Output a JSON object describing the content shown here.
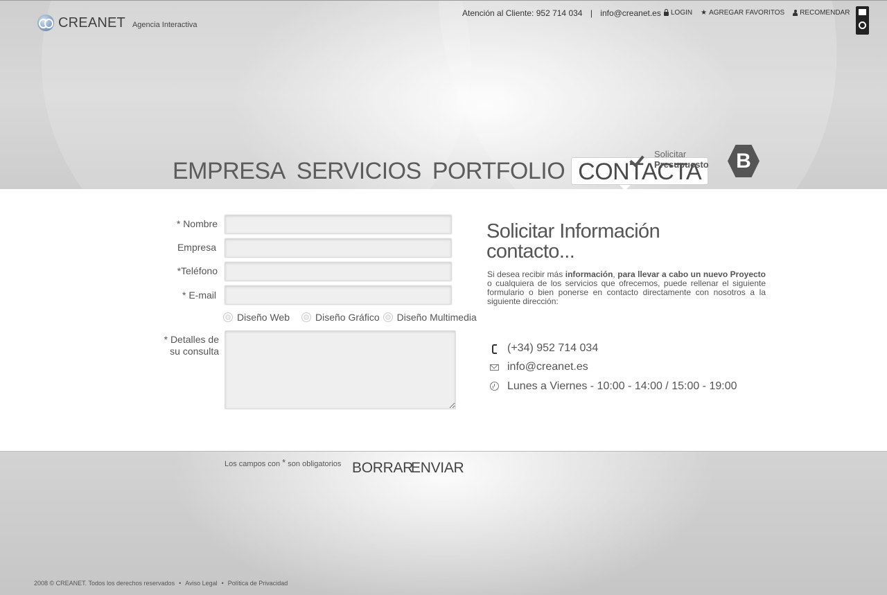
{
  "header": {
    "brand": "CREANET",
    "tagline": "Agencia Interactiva",
    "attention_text": "Atención al Cliente: 952 714 034",
    "separator": "|",
    "email_link": "info@creanet.es",
    "links": {
      "login": "LOGIN",
      "favorites": "AGREGAR FAVORITOS",
      "recommend": "RECOMENDAR"
    }
  },
  "nav": {
    "items": [
      {
        "label": "EMPRESA"
      },
      {
        "label": "SERVICIOS"
      },
      {
        "label": "PORTFOLIO"
      },
      {
        "label": "CONTACTA",
        "active": true
      }
    ]
  },
  "presupuesto": {
    "line1": "Solicitar",
    "line2": "Presupuesto",
    "badge": "B"
  },
  "form": {
    "fields": {
      "nombre": {
        "label": "* Nombre",
        "value": ""
      },
      "empresa": {
        "label": "Empresa",
        "value": ""
      },
      "telefono": {
        "label": "*Teléfono",
        "value": ""
      },
      "email": {
        "label": "* E-mail",
        "value": ""
      }
    },
    "options": [
      "Diseño Web",
      "Diseño Gráfico",
      "Diseño Multimedia"
    ],
    "details_label_1": "* Detalles de",
    "details_label_2": "su consulta",
    "required_note_pre": "Los campos con",
    "required_note_star": "*",
    "required_note_post": "son obligatorios",
    "reset_button": "BORRAR",
    "submit_button": "ENVIAR"
  },
  "info": {
    "title_1": "Solicitar Información",
    "title_2": "contacto...",
    "desc_1": "Si desea recibir más",
    "desc_b1": "información",
    "desc_2": ",",
    "desc_b2": "para llevar a cabo un nuevo Proyecto",
    "desc_3": "o cualquiera de los servicios que ofrecemos, puede rellenar el siguiente formulario o bien ponerse en contacto directamente con nosotros a la siguiente dirección:",
    "phone": "(+34) 952 714 034",
    "email": "info@creanet.es",
    "hours": "Lunes a Viernes - 10:00 - 14:00 / 15:00 - 19:00"
  },
  "footer": {
    "copyright": "2008 © CREANET. Todos los derechos reservados",
    "legal": "Aviso Legal",
    "privacy": "Política de Privacidad",
    "bullet": "•"
  }
}
